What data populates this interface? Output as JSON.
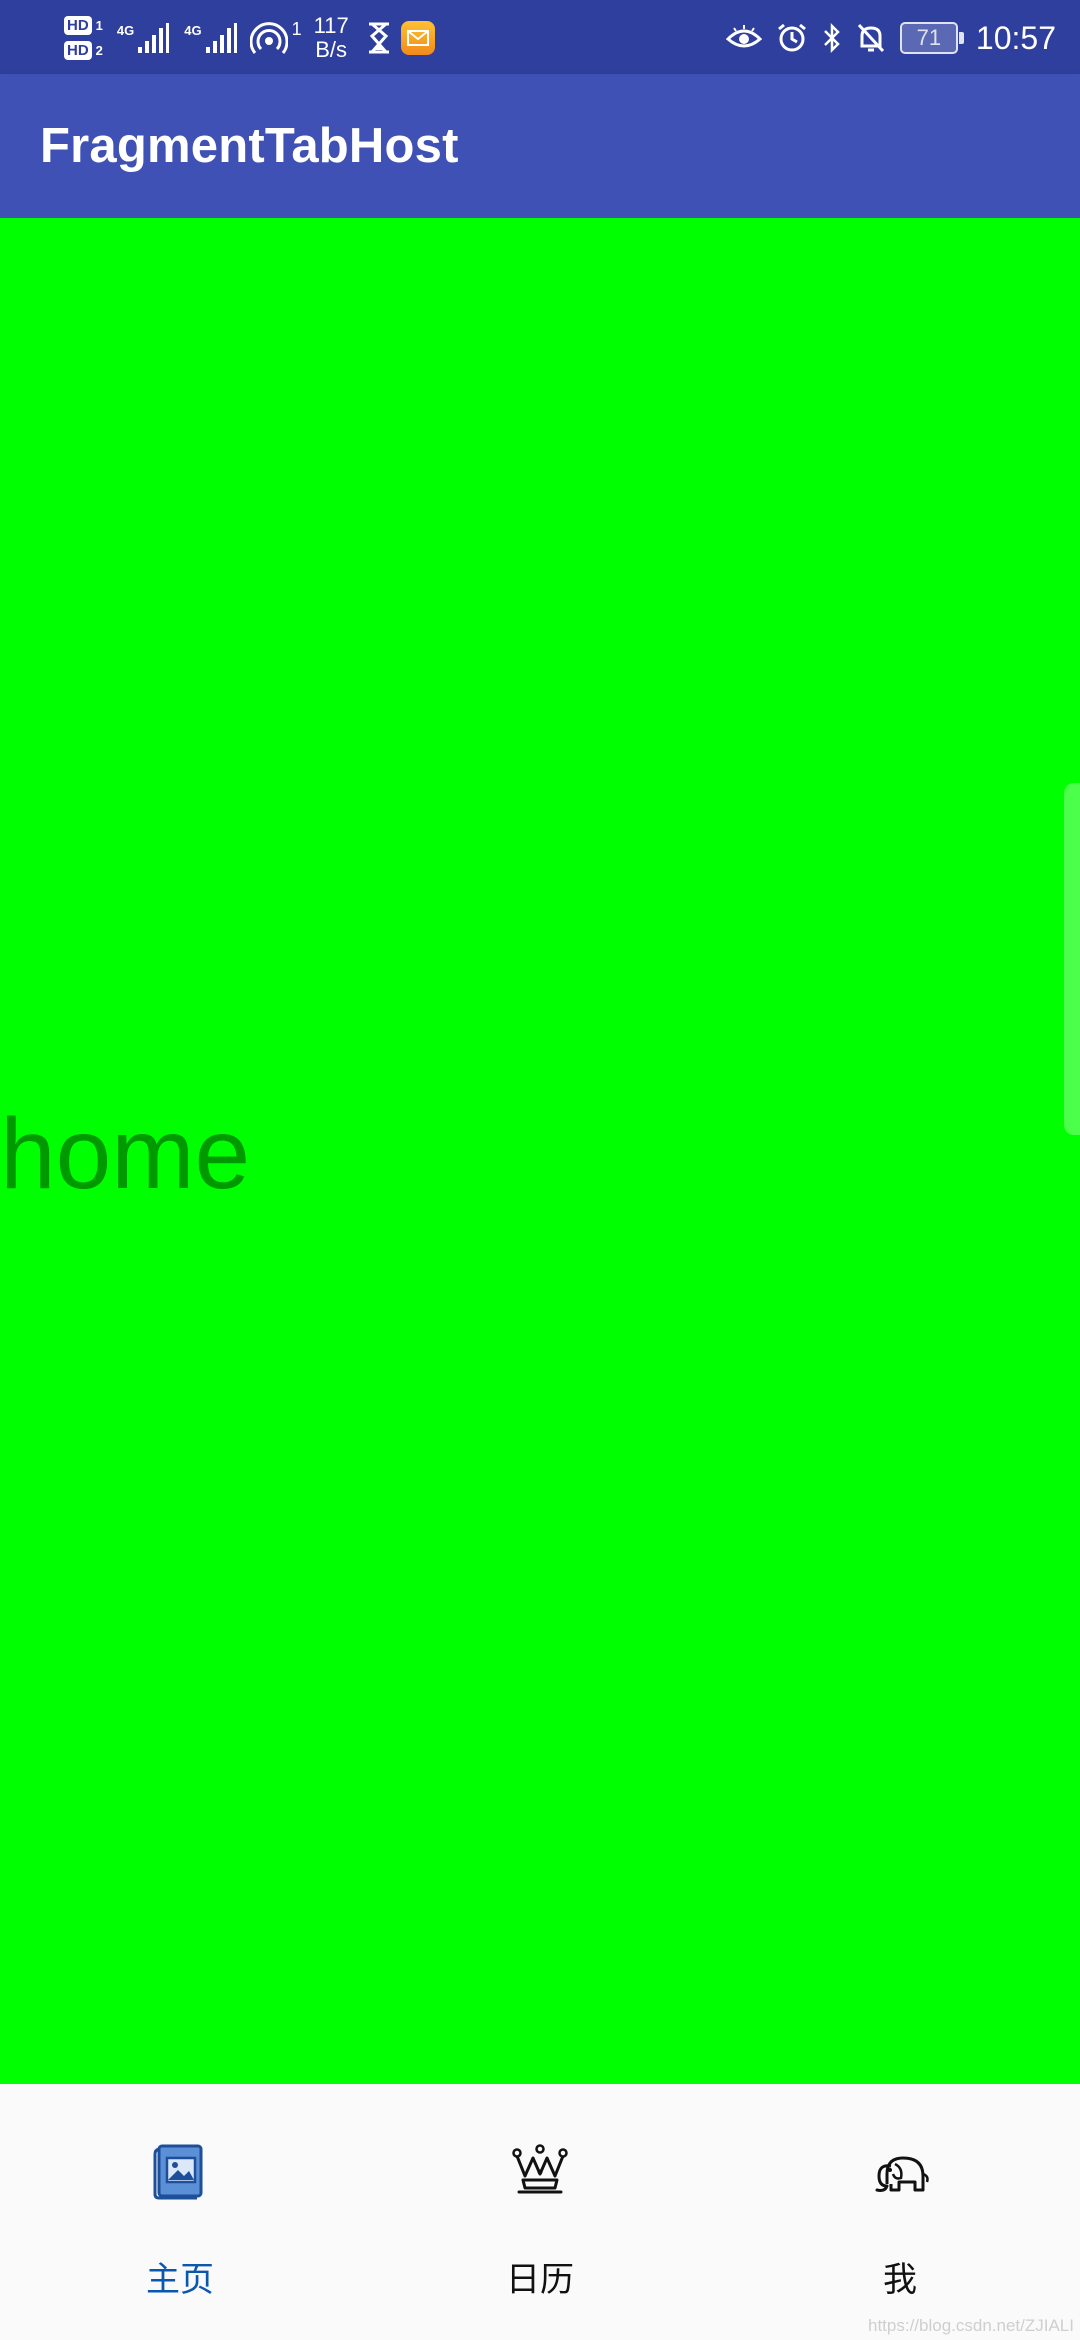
{
  "status_bar": {
    "sim1": "HD",
    "sim1_num": "1",
    "sim2": "HD",
    "sim2_num": "2",
    "network1": "4G",
    "network2": "4G",
    "hotspot_count": "1",
    "speed_value": "117",
    "speed_unit": "B/s",
    "icons_left": [
      "hd-icon",
      "signal-icon",
      "signal-icon",
      "hotspot-icon",
      "hourglass-icon",
      "mail-icon"
    ],
    "icons_right": [
      "eye-icon",
      "alarm-icon",
      "bluetooth-icon",
      "mute-icon",
      "battery-icon"
    ],
    "battery_level": "71",
    "time": "10:57"
  },
  "app_bar": {
    "title": "FragmentTabHost"
  },
  "content": {
    "text": "home",
    "background_color": "#00ff00"
  },
  "tabs": [
    {
      "label": "主页",
      "icon": "book-picture-icon",
      "active": true
    },
    {
      "label": "日历",
      "icon": "crown-icon",
      "active": false
    },
    {
      "label": "我",
      "icon": "elephant-icon",
      "active": false
    }
  ],
  "watermark": "https://blog.csdn.net/ZJIALI",
  "colors": {
    "status_bar": "#2f3f9e",
    "app_bar": "#3f51b5",
    "content": "#00ff00",
    "active_tab": "#0b57b0"
  }
}
